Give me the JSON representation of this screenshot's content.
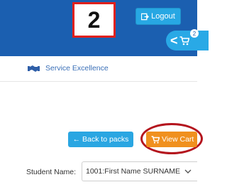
{
  "header": {
    "step_number": "2",
    "logout_label": "Logout",
    "cart_badge_count": "2",
    "brand_color": "#1b5fb0",
    "accent_color": "#29a9e6"
  },
  "subnav": {
    "service_label": "Service Excellence",
    "service_icon": "handshake-icon"
  },
  "actions": {
    "back_label": "← Back to packs",
    "view_cart_label": "View Cart",
    "view_cart_color": "#f0901e",
    "highlight_ring_color": "#b4141d"
  },
  "student": {
    "label": "Student Name:",
    "selected_value": "1001:First Name SURNAME"
  }
}
